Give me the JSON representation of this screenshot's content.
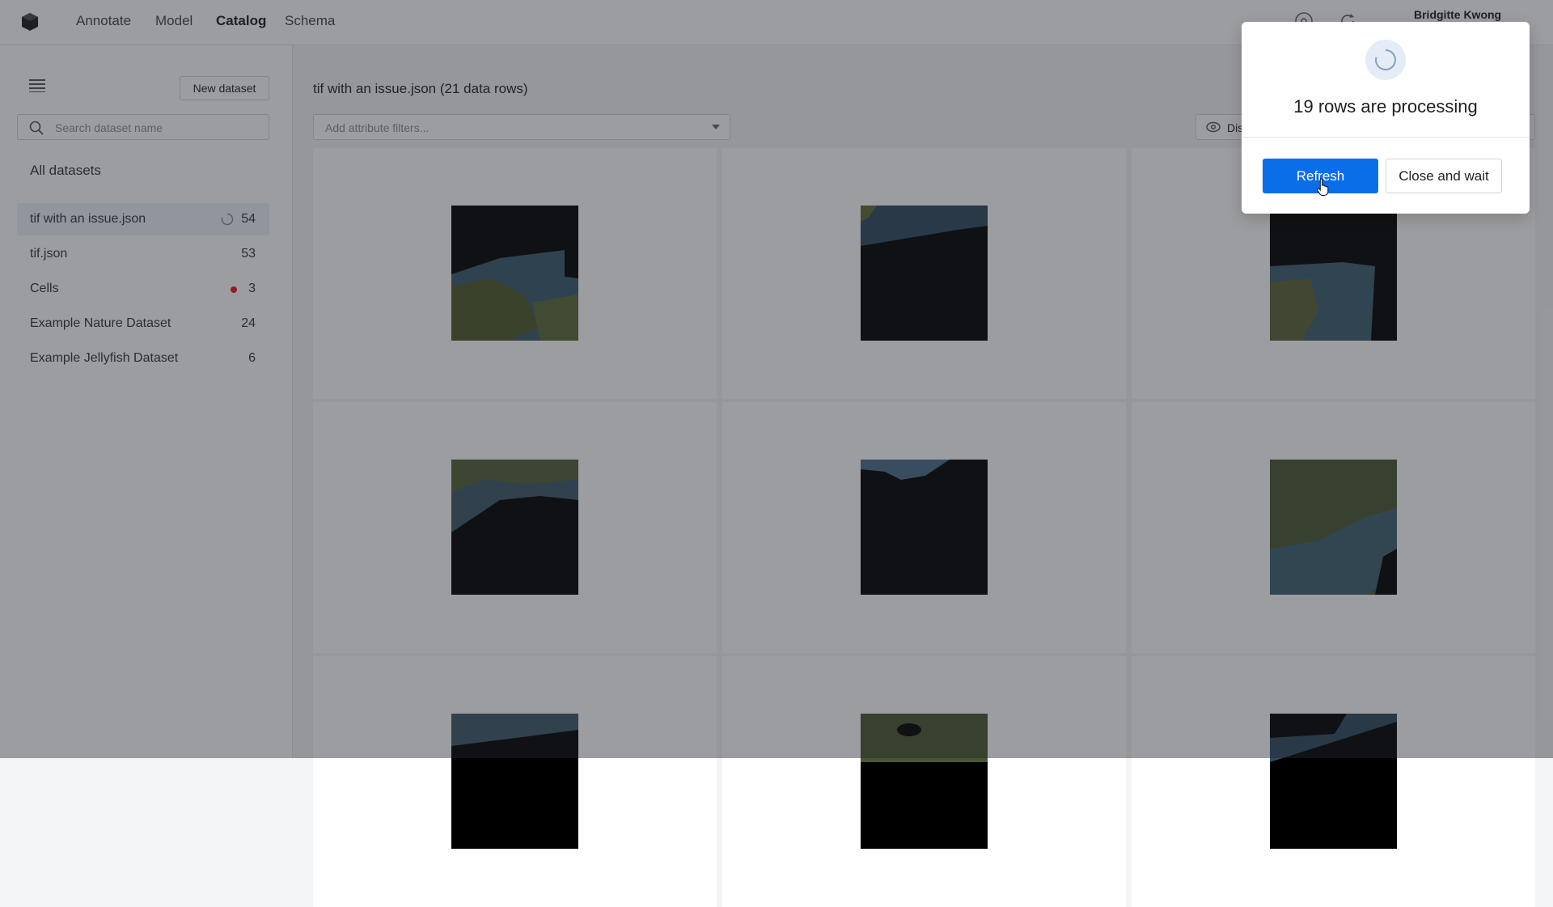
{
  "nav": {
    "links": [
      "Annotate",
      "Model",
      "Catalog",
      "Schema"
    ],
    "active": "Catalog",
    "user_name": "Bridgitte Kwong",
    "icons": [
      "logo-icon",
      "help-icon",
      "refresh-icon"
    ]
  },
  "sidebar": {
    "new_dataset_label": "New dataset",
    "search_placeholder": "Search dataset name",
    "all_datasets_label": "All datasets",
    "items": [
      {
        "label": "tif with an issue.json",
        "count": "54",
        "status": "processing",
        "selected": true
      },
      {
        "label": "tif.json",
        "count": "53"
      },
      {
        "label": "Cells",
        "count": "3",
        "status": "error"
      },
      {
        "label": "Example Nature Dataset",
        "count": "24"
      },
      {
        "label": "Example Jellyfish Dataset",
        "count": "6"
      }
    ]
  },
  "main": {
    "dataset_title": "tif with an issue.json",
    "row_count": "(21 data rows)",
    "filter_placeholder": "Add attribute filters...",
    "display_label": "Dis"
  },
  "modal": {
    "title": "19 rows are processing",
    "refresh_label": "Refresh",
    "close_label": "Close and wait"
  },
  "colors": {
    "primary": "#0b6ee9",
    "overlay": "rgba(35,38,44,0.45)",
    "error_dot": "#e51b23"
  }
}
